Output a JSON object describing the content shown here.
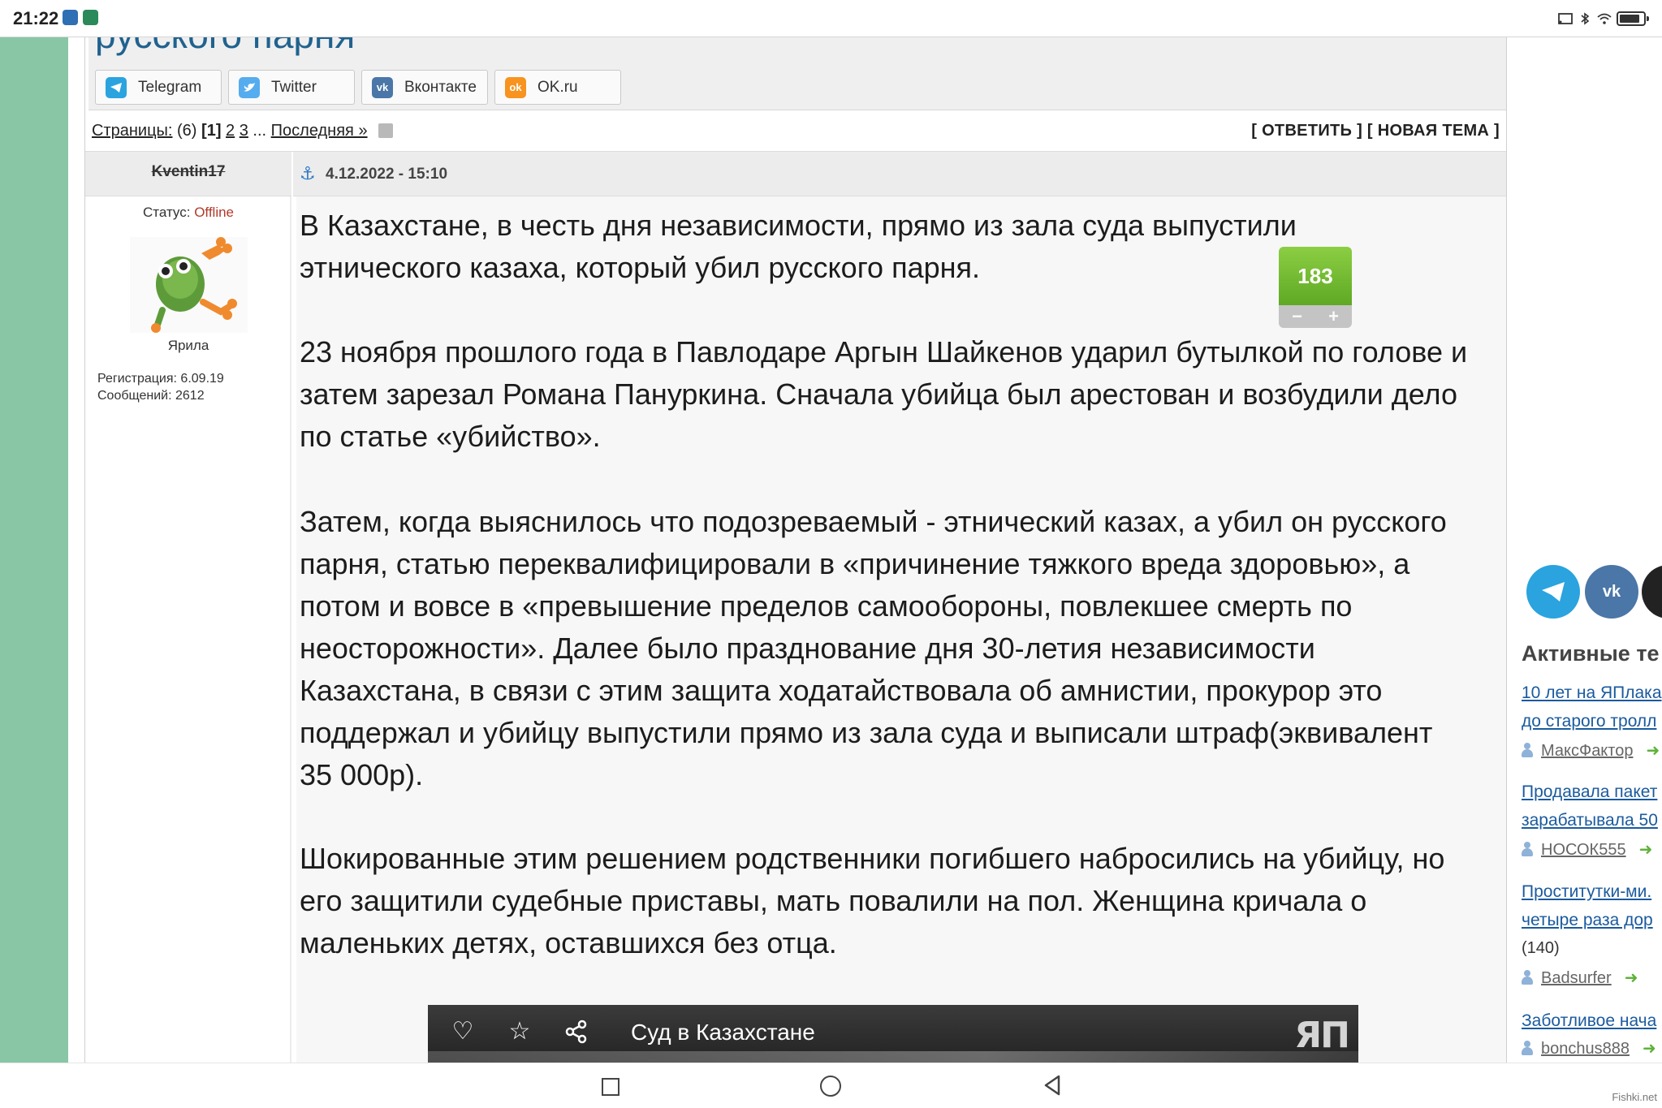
{
  "statusbar": {
    "time": "21:22"
  },
  "page": {
    "title_fragment": "русского парня",
    "share_buttons": [
      {
        "label": "Telegram",
        "icon": "telegram-icon",
        "color": "#2aa3df"
      },
      {
        "label": "Twitter",
        "icon": "twitter-icon",
        "color": "#55acee"
      },
      {
        "label": "Вконтакте",
        "icon": "vk-icon",
        "color": "#4a76a8"
      },
      {
        "label": "OK.ru",
        "icon": "ok-icon",
        "color": "#f7931e"
      }
    ],
    "pagination": {
      "label": "Страницы:",
      "count": "(6)",
      "current": "[1]",
      "page2": "2",
      "page3": "3",
      "ellipsis": "...",
      "last": "Последняя »"
    },
    "actions": "[ ОТВЕТИТЬ ] [ НОВАЯ ТЕМА ]"
  },
  "post": {
    "author": "Kventin17",
    "date": "4.12.2022 - 15:10",
    "status_label": "Статус:",
    "status_value": "Offline",
    "avatar_caption": "Ярила",
    "registration": "Регистрация: 6.09.19",
    "messages": "Сообщений: 2612",
    "rating": "183",
    "rating_minus": "−",
    "rating_plus": "+",
    "paragraphs": [
      "В Казахстане, в честь дня независимости, прямо из зала суда выпустили этнического казаха, который убил русского парня.",
      "23 ноября прошлого года в Павлодаре Аргын Шайкенов ударил бутылкой по голове и затем зарезал Романа Пануркина. Сначала убийца был арестован и возбудили дело по статье «убийство».",
      "Затем, когда выяснилось что подозреваемый - этнический казах, а убил он русского парня, статью переквалифицировали в «причинение тяжкого вреда здоровью», а потом и вовсе в «превышение пределов самообороны, повлекшее смерть по неосторожности». Далее было празднование дня 30-летия независимости Казахстана, в связи с этим защита ходатайствовала об амнистии, прокурор это поддержал и убийцу выпустили прямо из зала суда и выписали штраф(эквивалент 35 000р).",
      "Шокированные этим решением родственники погибшего набросились на убийцу, но его защитили судебные приставы, мать повалили на пол. Женщина кричала о маленьких детях, оставшихся без отца."
    ],
    "video": {
      "title": "Суд в Казахстане",
      "logo": "ЯП"
    }
  },
  "sidebar": {
    "active_title": "Активные те",
    "topics": [
      {
        "line1": "10 лет на ЯПлака",
        "line2": "до старого тролл",
        "count": "",
        "user": "МаксФактор"
      },
      {
        "line1": "Продавала пакет",
        "line2": "зарабатывала 50",
        "count": "",
        "user": "НОСОК555"
      },
      {
        "line1": "Проститутки-ми.",
        "line2": "четыре раза дор",
        "count": "(140)",
        "user": "Badsurfer"
      },
      {
        "line1": "Заботливое нача",
        "line2": "",
        "count": "",
        "user": "bonchus888"
      }
    ]
  },
  "watermark": "Fishki.net"
}
